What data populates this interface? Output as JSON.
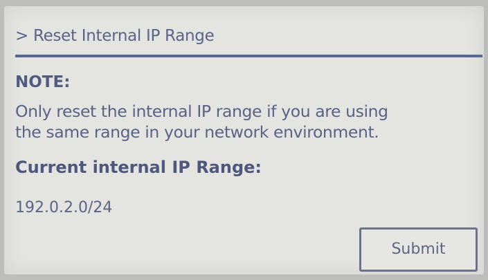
{
  "header": {
    "title": "> Reset Internal IP Range"
  },
  "note": {
    "heading": "NOTE:",
    "line1": "Only reset the internal IP range if you are using",
    "line2": "the same range in your network environment."
  },
  "current_range": {
    "heading": "Current internal IP Range:",
    "value": "192.0.2.0/24"
  },
  "actions": {
    "submit_label": "Submit"
  }
}
